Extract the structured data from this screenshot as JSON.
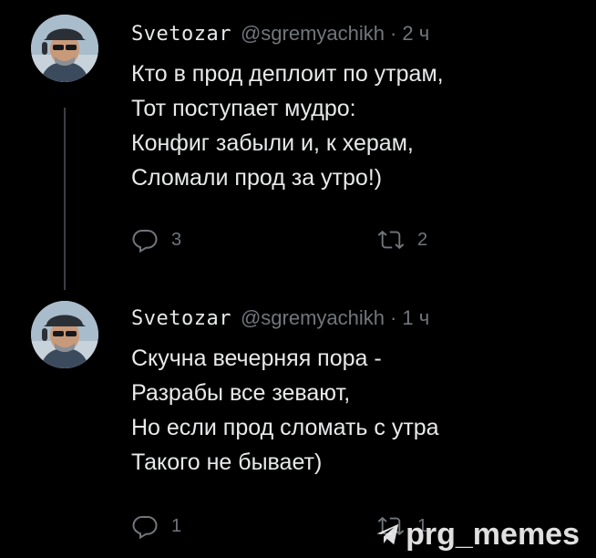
{
  "tweets": [
    {
      "author": "Svetozar",
      "handle": "@sgremyachikh",
      "separator": "·",
      "time": "2 ч",
      "lines": [
        "Кто в прод деплоит по утрам,",
        "Тот поступает мудро:",
        "Конфиг забыли и, к херам,",
        "Сломали прод за утро!)"
      ],
      "reply_count": "3",
      "retweet_count": "2"
    },
    {
      "author": "Svetozar",
      "handle": "@sgremyachikh",
      "separator": "·",
      "time": "1 ч",
      "lines": [
        "Скучна вечерняя пора -",
        "Разрабы все зевают,",
        "Но если прод сломать с утра",
        "Такого не бывает)"
      ],
      "reply_count": "1",
      "retweet_count": "1"
    }
  ],
  "watermark": "prg_memes",
  "icons": {
    "reply": "reply-icon",
    "retweet": "retweet-icon",
    "watermark": "paper-plane-icon"
  },
  "colors": {
    "background": "#000000",
    "text": "#e7e9ea",
    "muted": "#71767b",
    "thread_line": "#3a3f44"
  }
}
